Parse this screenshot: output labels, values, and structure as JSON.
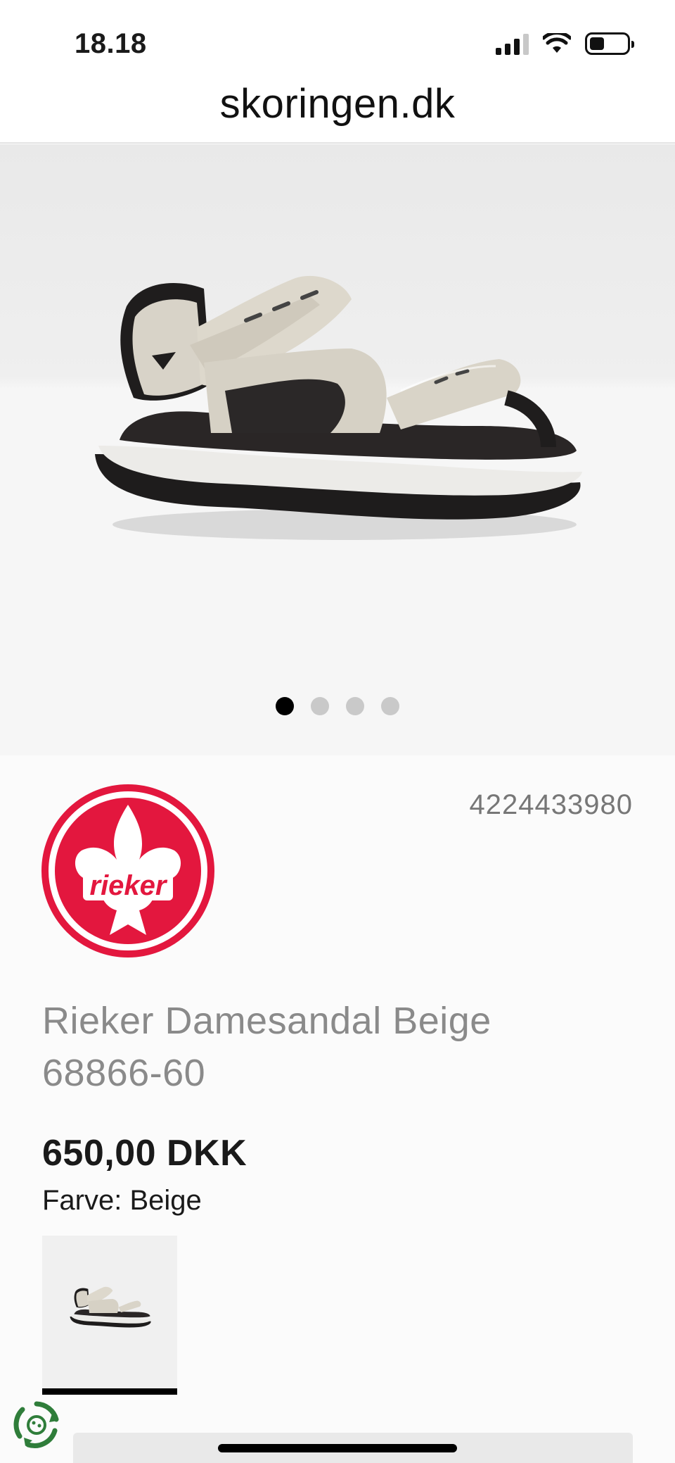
{
  "status_bar": {
    "time": "18.18"
  },
  "browser": {
    "url": "skoringen.dk"
  },
  "gallery": {
    "image_icon": "sandal-image",
    "slide_count": 4,
    "active_slide": 1
  },
  "product": {
    "sku": "4224433980",
    "brand_logo_text": "rieker",
    "title": "Rieker Damesandal Beige 68866-60",
    "price": "650,00 DKK",
    "color_label": "Farve: Beige",
    "colors": {
      "brand_red": "#e3173e",
      "accent_black": "#000000"
    }
  }
}
